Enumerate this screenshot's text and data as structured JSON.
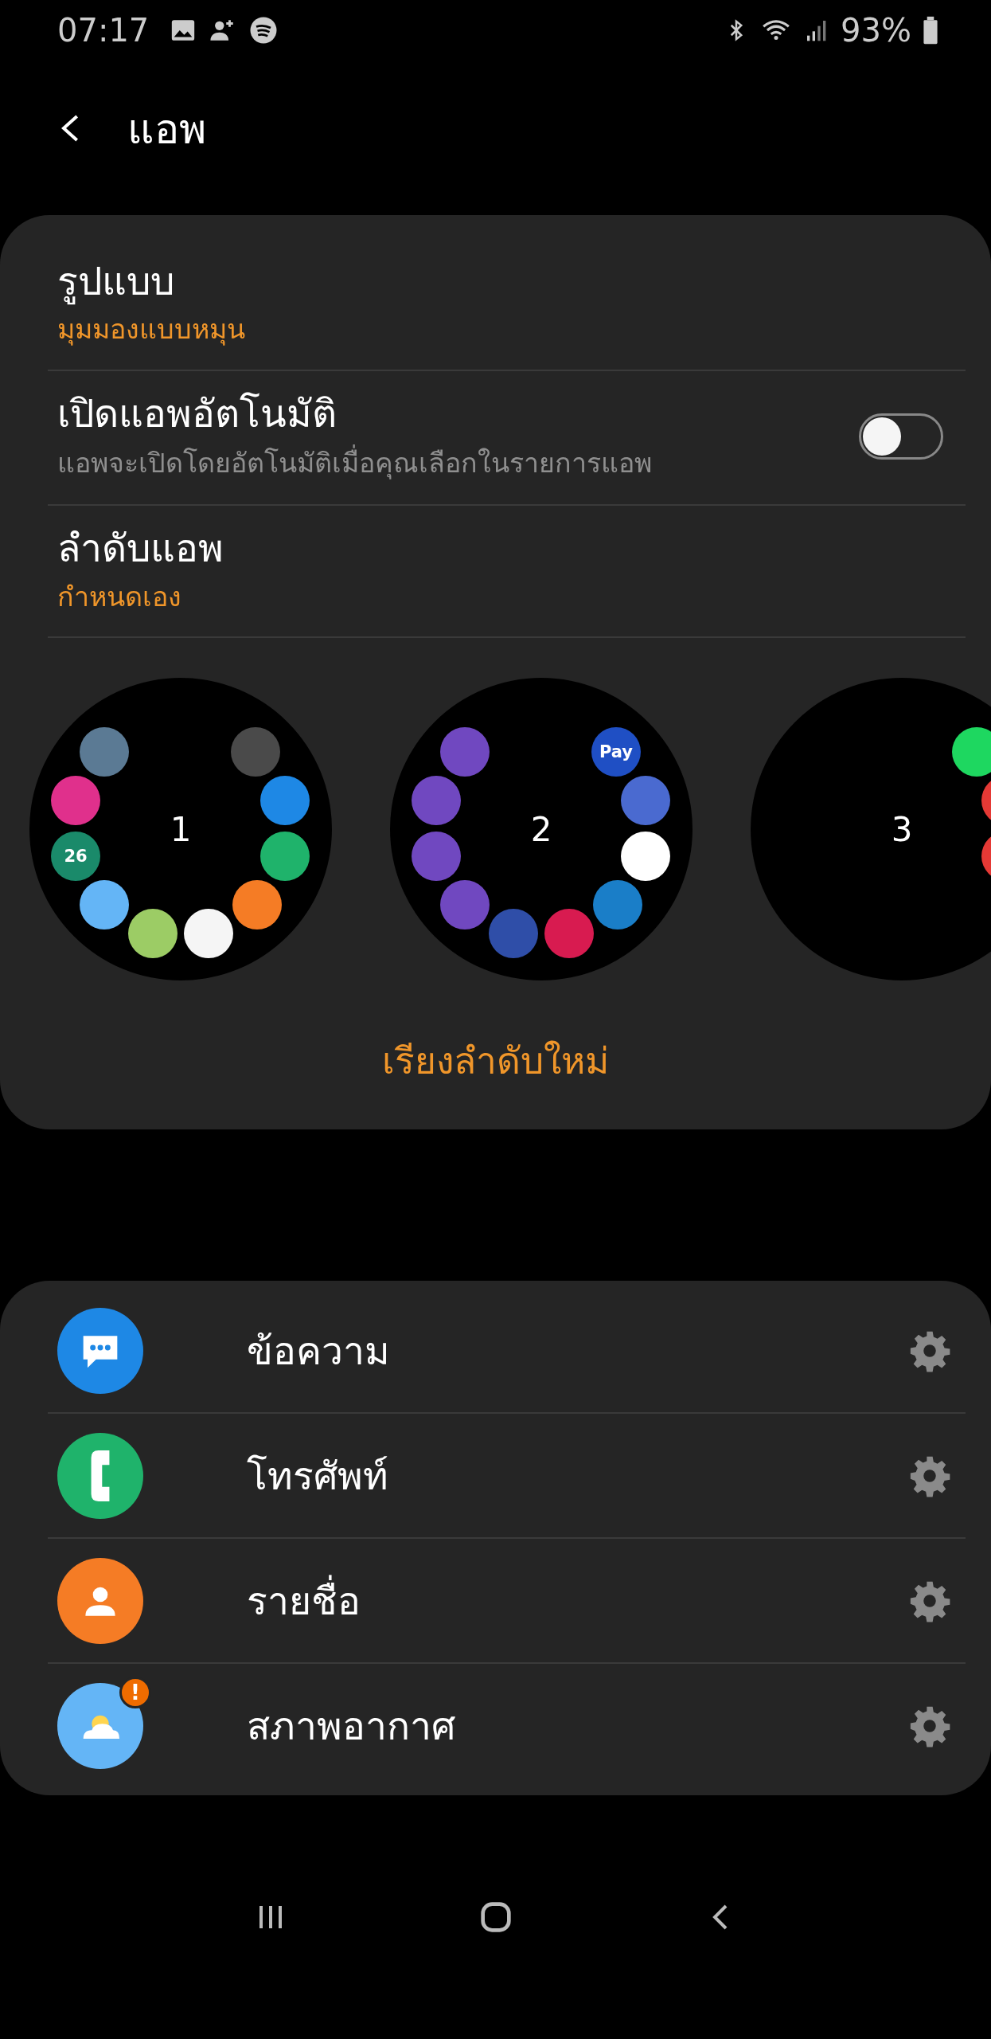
{
  "status_bar": {
    "time": "07:17",
    "battery": "93%"
  },
  "header": {
    "title": "แอพ"
  },
  "settings": [
    {
      "kind": "value",
      "title": "รูปแบบ",
      "value": "มุมมองแบบหมุน"
    },
    {
      "kind": "toggle",
      "title": "เปิดแอพอัตโนมัติ",
      "description": "แอพจะเปิดโดยอัตโนมัติเมื่อคุณเลือกในรายการแอพ",
      "on": false
    },
    {
      "kind": "value",
      "title": "ลำดับแอพ",
      "value": "กำหนดเอง"
    }
  ],
  "pages": [
    {
      "number": "1",
      "apps": [
        {
          "color": "#4a4a4a"
        },
        {
          "color": "#1e88e5"
        },
        {
          "color": "#1fb36b"
        },
        {
          "color": "#f57c25"
        },
        {
          "color": "#f5f5f5"
        },
        {
          "color": "#9ccc65"
        },
        {
          "color": "#64b5f6"
        },
        {
          "color": "#1a8a6a",
          "label": "26"
        },
        {
          "color": "#e0308c"
        },
        {
          "color": "#5b7a94"
        }
      ]
    },
    {
      "number": "2",
      "apps": [
        {
          "color": "#1f4fc4",
          "label": "Pay"
        },
        {
          "color": "#4a6ad0"
        },
        {
          "color": "#ffffff"
        },
        {
          "color": "#1a7ec8"
        },
        {
          "color": "#d81b50"
        },
        {
          "color": "#2f4ea8"
        },
        {
          "color": "#7048c0"
        },
        {
          "color": "#7048c0"
        },
        {
          "color": "#7048c0"
        },
        {
          "color": "#7048c0"
        }
      ]
    },
    {
      "number": "3",
      "apps": [
        {
          "color": "#1ed760"
        },
        {
          "color": "#e53935"
        },
        {
          "color": "#e53935"
        }
      ]
    }
  ],
  "reorder_button": "เรียงลำดับใหม่",
  "apps": [
    {
      "name": "ข้อความ",
      "color": "#1e88e5"
    },
    {
      "name": "โทรศัพท์",
      "color": "#1fb36b"
    },
    {
      "name": "รายชื่อ",
      "color": "#f57c25"
    },
    {
      "name": "สภาพอากาศ",
      "color": "#64b5f6",
      "badge": "!"
    }
  ]
}
